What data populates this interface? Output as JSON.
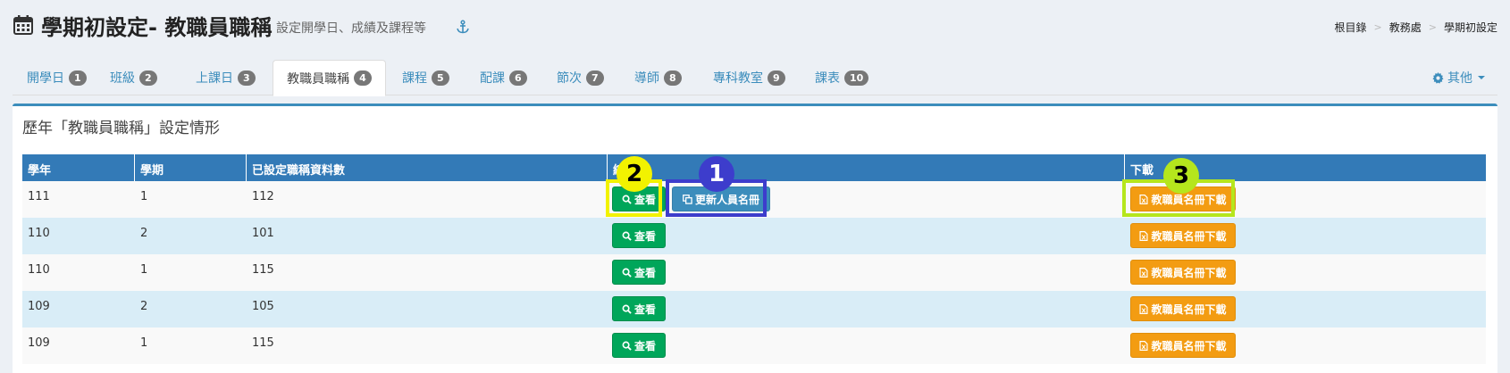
{
  "header": {
    "title": "學期初設定- 教職員職稱",
    "subtitle": "設定開學日、成績及課程等",
    "calendar_icon": "calendar-icon",
    "anchor_icon": "anchor-icon"
  },
  "breadcrumb": {
    "items": [
      "根目錄",
      "教務處",
      "學期初設定"
    ],
    "separator": ">"
  },
  "tabs": [
    {
      "label": "開學日",
      "count": "1"
    },
    {
      "label": "班級",
      "count": "2"
    },
    {
      "label": "上課日",
      "count": "3"
    },
    {
      "label": "教職員職稱",
      "count": "4",
      "active": true
    },
    {
      "label": "課程",
      "count": "5"
    },
    {
      "label": "配課",
      "count": "6"
    },
    {
      "label": "節次",
      "count": "7"
    },
    {
      "label": "導師",
      "count": "8"
    },
    {
      "label": "專科教室",
      "count": "9"
    },
    {
      "label": "課表",
      "count": "10"
    }
  ],
  "more_menu": {
    "label": "其他",
    "icon": "gear-icon"
  },
  "box": {
    "title": "歷年「教職員職稱」設定情形"
  },
  "table": {
    "headers": [
      "學年",
      "學期",
      "已設定職稱資料數",
      "編",
      "下載"
    ],
    "rows": [
      {
        "year": "111",
        "semester": "1",
        "count": "112"
      },
      {
        "year": "110",
        "semester": "2",
        "count": "101"
      },
      {
        "year": "110",
        "semester": "1",
        "count": "115"
      },
      {
        "year": "109",
        "semester": "2",
        "count": "105"
      },
      {
        "year": "109",
        "semester": "1",
        "count": "115"
      }
    ],
    "view_label": "查看",
    "update_label": "更新人員名冊",
    "download_label": "教職員名冊下載"
  },
  "annotations": [
    {
      "number": "1",
      "color": "#3d3dcc",
      "text_color": "#ffffff"
    },
    {
      "number": "2",
      "color": "#f2f200",
      "text_color": "#000000"
    },
    {
      "number": "3",
      "color": "#b5e61d",
      "text_color": "#000000"
    }
  ],
  "colors": {
    "primary": "#3c8dbc",
    "header_bg": "#337ab7",
    "success": "#00a65a",
    "warning": "#f39c12",
    "badge": "#777777"
  }
}
